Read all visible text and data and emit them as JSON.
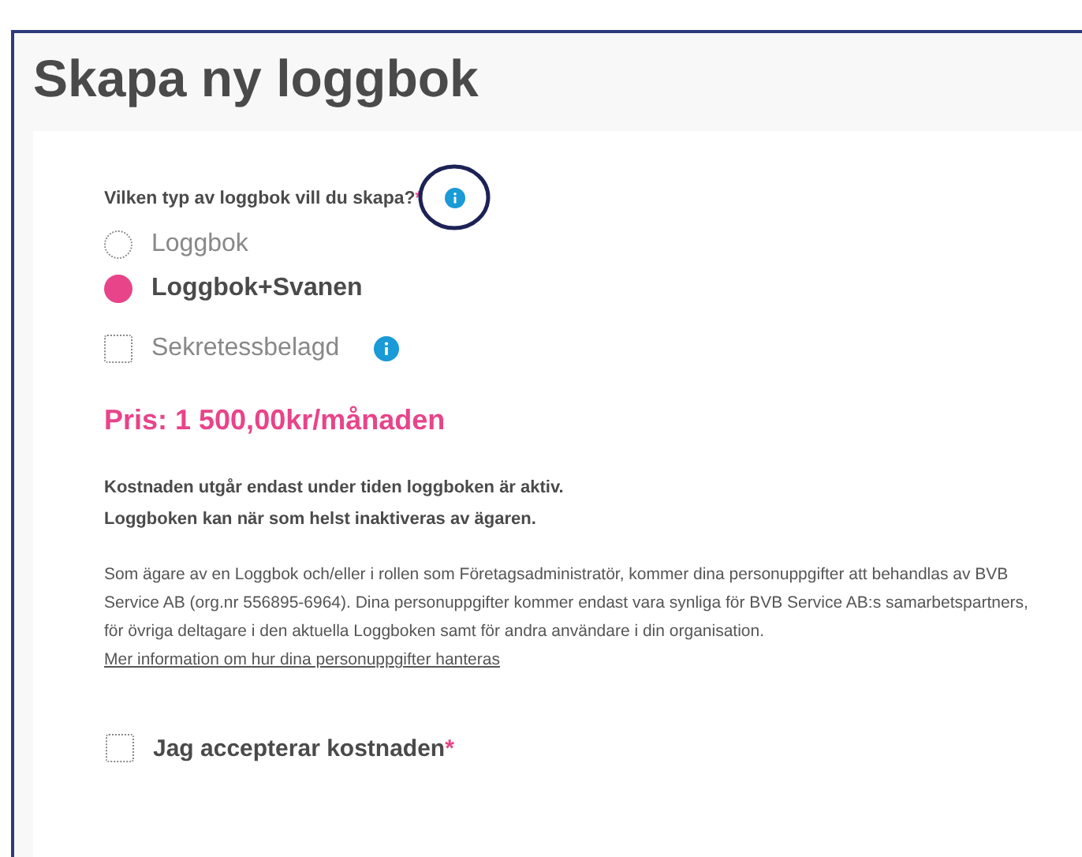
{
  "page_title": "Skapa ny loggbok",
  "question": {
    "label": "Vilken typ av loggbok vill du skapa?",
    "required_mark": "*",
    "highlighted": true
  },
  "options": [
    {
      "kind": "radio",
      "label": "Loggbok",
      "selected": false,
      "info": false
    },
    {
      "kind": "radio",
      "label": "Loggbok+Svanen",
      "selected": true,
      "info": false
    },
    {
      "kind": "checkbox",
      "label": "Sekretessbelagd",
      "checked": false,
      "info": true
    }
  ],
  "price": "Pris: 1 500,00kr/månaden",
  "notice_lines": [
    "Kostnaden utgår endast under tiden loggboken är aktiv.",
    "Loggboken kan när som helst inaktiveras av ägaren."
  ],
  "privacy_text": "Som ägare av en Loggbok och/eller i rollen som Företagsadministratör, kommer dina personuppgifter att behandlas av BVB Service AB (org.nr 556895-6964). Dina personuppgifter kommer endast vara synliga för BVB Service AB:s samarbetspartners, för övriga deltagare i den aktuella Loggboken samt för andra användare i din organisation.",
  "privacy_link": "Mer information om hur dina personuppgifter hanteras",
  "accept": {
    "label": "Jag accepterar kostnaden",
    "required_mark": "*",
    "checked": false
  }
}
